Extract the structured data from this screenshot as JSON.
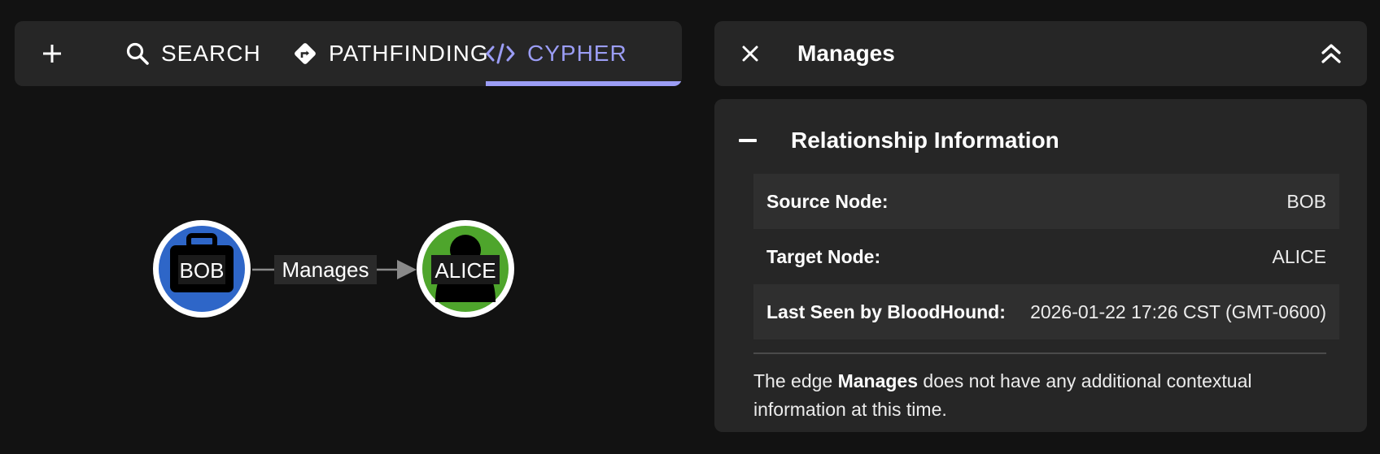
{
  "tabs": {
    "add_label": "+",
    "search_label": "SEARCH",
    "pathfinding_label": "PATHFINDING",
    "cypher_label": "CYPHER",
    "active": "CYPHER",
    "accent_color": "#9b9df5"
  },
  "graph": {
    "nodes": [
      {
        "label": "BOB",
        "icon": "briefcase-icon",
        "color": "#2e66c8"
      },
      {
        "label": "ALICE",
        "icon": "user-icon",
        "color": "#4ea52c"
      }
    ],
    "edge": {
      "label": "Manages",
      "source": "BOB",
      "target": "ALICE"
    }
  },
  "panel": {
    "title": "Manages",
    "close_icon": "close-icon",
    "collapse_icon": "double-chevron-up-icon",
    "section": {
      "title": "Relationship Information",
      "rows": [
        {
          "key": "Source Node:",
          "value": "BOB"
        },
        {
          "key": "Target Node:",
          "value": "ALICE"
        },
        {
          "key": "Last Seen by BloodHound:",
          "value": "2026-01-22 17:26 CST (GMT-0600)"
        }
      ],
      "note_prefix": "The edge ",
      "note_bold": "Manages",
      "note_suffix": " does not have any additional contextual information at this time."
    }
  }
}
